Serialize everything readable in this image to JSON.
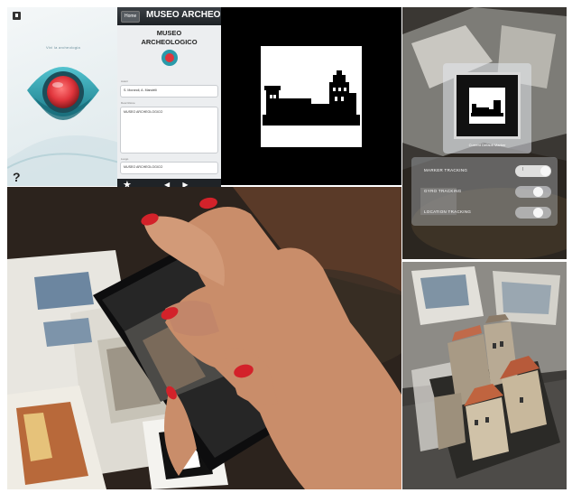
{
  "splash": {
    "tagline": "Vivi la archeologia",
    "help_label": "?"
  },
  "app": {
    "back_label": "Home",
    "nav_title": "MUSEO ARCHEOLOGICO",
    "heading_line1": "MUSEO",
    "heading_line2": "ARCHEOLOGICO",
    "author_label": "Autori",
    "author_value": "S. Morandi, A. Mandelli",
    "description_label": "Descrizione",
    "description_value": "MUSEO ARCHEOLOGICO",
    "location_label": "Luogo",
    "location_value": "MUSEO ARCHEOLOGICO",
    "tab_star": "★",
    "tab_arrows": "◀ ▶"
  },
  "settings": {
    "dialog_label": "Current Default Marker",
    "rows": [
      {
        "label": "MARKER TRACKING",
        "state": "on",
        "toggle_text": "I"
      },
      {
        "label": "GYRO TRACKING",
        "state": "off",
        "toggle_text": ""
      },
      {
        "label": "LOCATION TRACKING",
        "state": "off",
        "toggle_text": ""
      }
    ]
  },
  "colors": {
    "lens_red": "#e0353c",
    "eye_teal": "#2a9aaa",
    "nail_red": "#d3222a"
  }
}
